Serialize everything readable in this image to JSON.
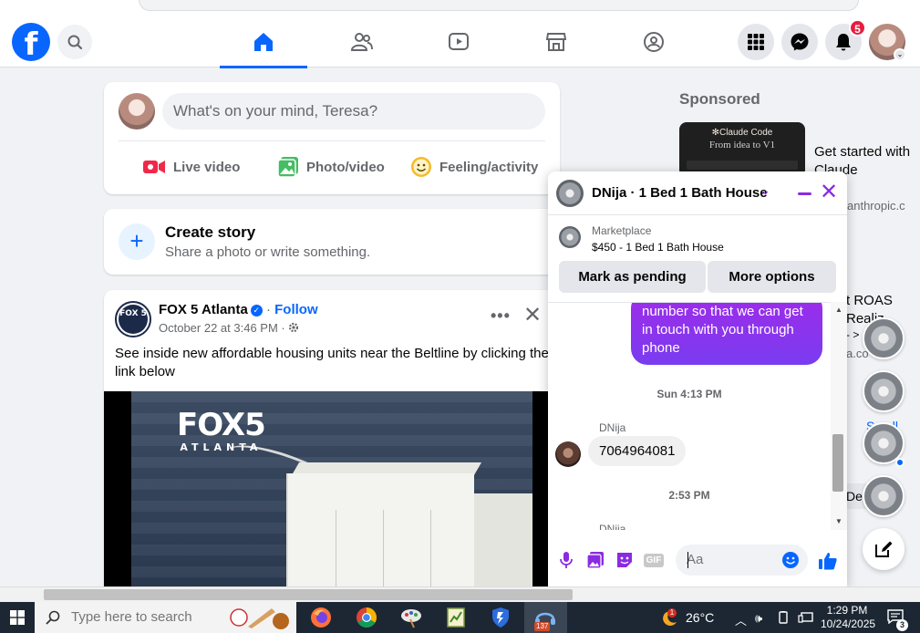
{
  "composer": {
    "placeholder": "What's on your mind, Teresa?",
    "actions": {
      "live": "Live video",
      "photo": "Photo/video",
      "feeling": "Feeling/activity"
    }
  },
  "story": {
    "title": "Create story",
    "subtitle": "Share a photo or write something."
  },
  "post": {
    "page_name": "FOX 5 Atlanta",
    "follow": "Follow",
    "date": "October 22 at 3:46 PM",
    "separator": "·",
    "text": "See inside new affordable housing units near the Beltline by clicking the link below",
    "logo_text": "FOX 5",
    "image_watermark": {
      "line1": "FOX5",
      "line2": "ATLANTA"
    }
  },
  "nav": {
    "notification_count": "5"
  },
  "sponsored": {
    "heading": "Sponsored",
    "ad1": {
      "thumb_line1": "✻Claude Code",
      "thumb_line2": "From idea to V1",
      "text": "Get started with Claude",
      "domain": "anthropic.c"
    },
    "ad2": {
      "text_line1": "t ROAS",
      "text_line2": "Realiz",
      "text_line3": "- >",
      "domain": "a.co"
    },
    "link": "Se all",
    "de_label": "De"
  },
  "chat": {
    "title": "DNija · 1 Bed 1 Bath House",
    "marketplace_label": "Marketplace",
    "marketplace_item": "$450 - 1 Bed 1 Bath House",
    "mark_pending": "Mark as pending",
    "more_options": "More options",
    "outgoing_message": "number so that we can get in touch with you through phone",
    "timestamp1": "Sun 4:13 PM",
    "sender1": "DNija",
    "incoming_message": "7064964081",
    "timestamp2": "2:53 PM",
    "sender2": "DNiia",
    "input_placeholder": "Aa",
    "gif_label": "GIF"
  },
  "taskbar": {
    "search_placeholder": "Type here to search",
    "weather": "26°C",
    "time": "1:29 PM",
    "date": "10/24/2025",
    "app_badge": "137",
    "weather_badge": "1",
    "notif_count": "3"
  },
  "colors": {
    "facebook_blue": "#0866ff",
    "messenger_purple": "#8a2be2",
    "badge_red": "#e41e3f"
  }
}
